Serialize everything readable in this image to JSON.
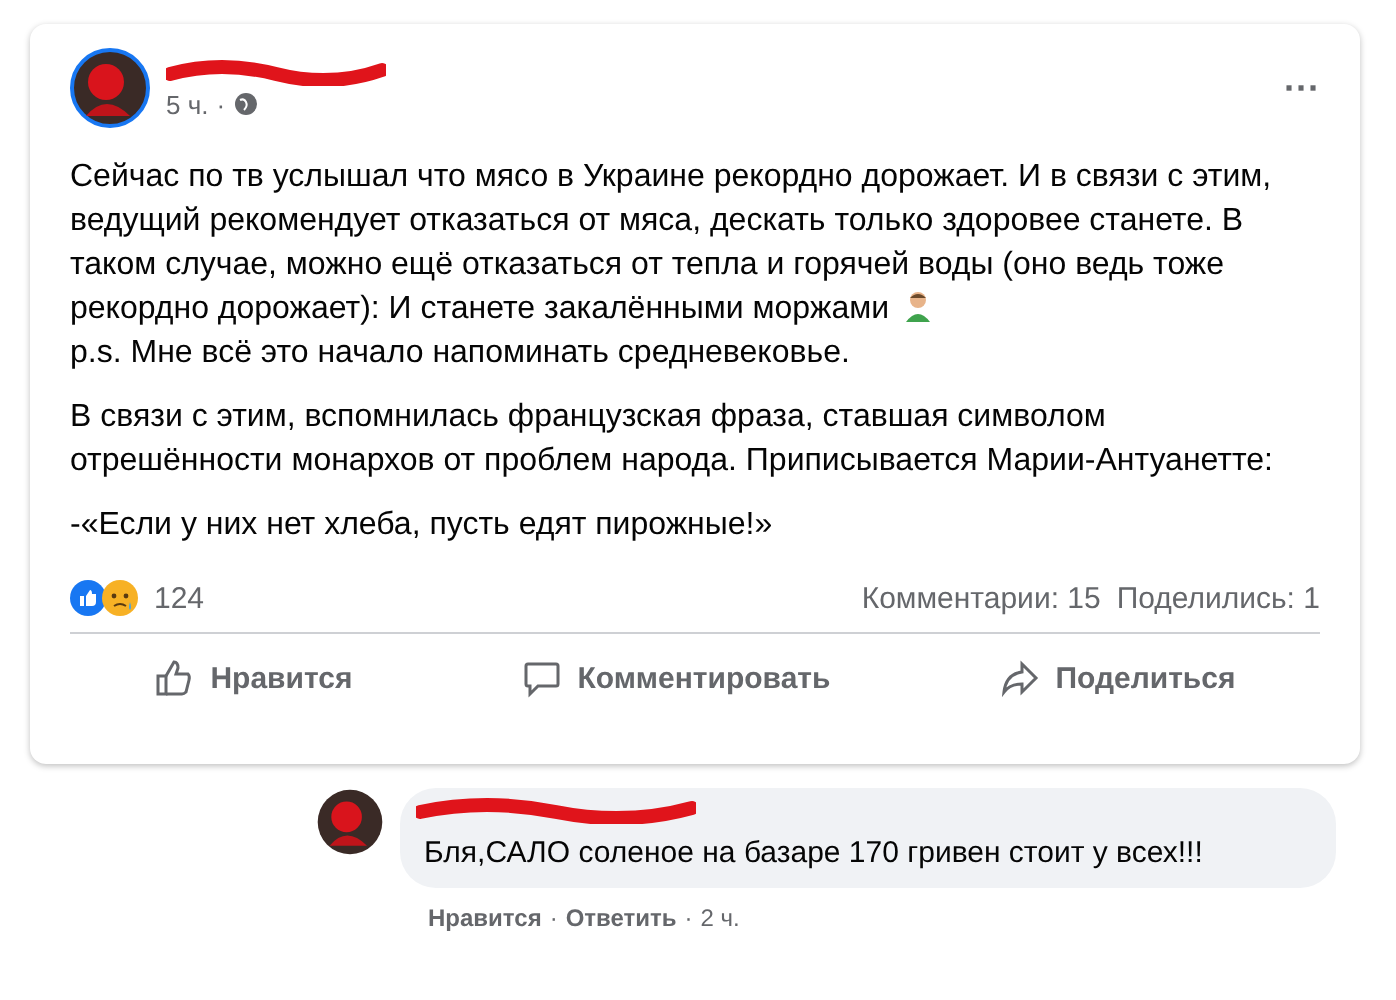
{
  "post": {
    "time": "5 ч.",
    "time_separator": "·",
    "more": "···",
    "paragraphs": [
      "Сейчас по тв услышал что мясо в Украине рекордно дорожает. И в связи с этим, ведущий рекомендует отказаться от мяса, дескать только здоровее станете. В таком случае, можно ещё отказаться от тепла и горячей воды (оно ведь тоже рекордно дорожает): И станете закалёнными моржами",
      "p.s. Мне всё это начало напоминать средневековье.",
      "В связи с этим, вспомнилась  французская фраза, ставшая символом отрешённости монархов от проблем народа. Приписывается Марии-Антуанетте:",
      "-«Если у них нет хлеба, пусть едят пирожные!»"
    ],
    "reactions_count": "124",
    "comments": "Комментарии: 15",
    "shares": "Поделились: 1",
    "actions": [
      {
        "kind": "like",
        "label": "Нравится"
      },
      {
        "kind": "comment",
        "label": "Комментировать"
      },
      {
        "kind": "share",
        "label": "Поделиться"
      }
    ]
  },
  "comment": {
    "text": "Бля,САЛО соленое на базаре 170 гривен стоит у всех!!!",
    "like": "Нравится",
    "reply": "Ответить",
    "time": "2 ч.",
    "separator": "·"
  }
}
